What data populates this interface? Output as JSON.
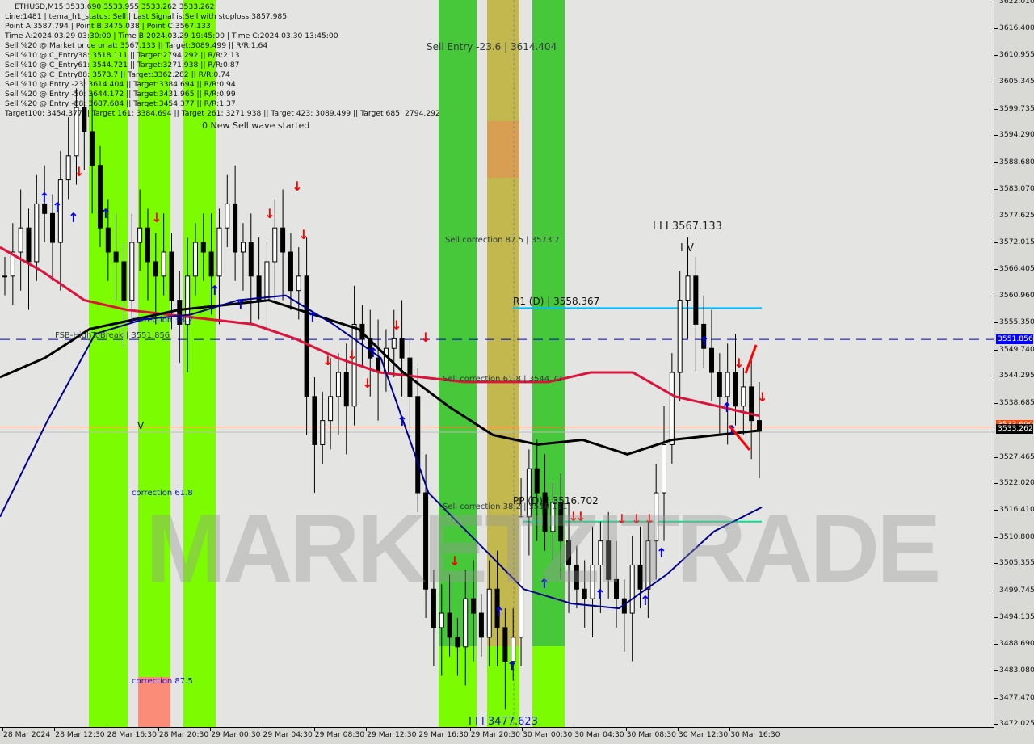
{
  "window": {
    "symbol_line": "ETHUSD,M15  3533.690 3533.955 3533.262 3533.262"
  },
  "info_panel": {
    "lines": [
      "Line:1481 | tema_h1_status: Sell | Last Signal is:Sell with stoploss:3857.985",
      "Point A:3587.794 | Point B:3475.038 | Point C:3567.133",
      "Time A:2024.03.29 03:30:00 | Time B:2024.03.29 19:45:00 | Time C:2024.03.30 13:45:00",
      "Sell %20 @ Market price or at: 3567.133 || Target:3089.499 || R/R:1.64",
      "Sell %10 @ C_Entry38: 3518.111 || Target:2794.292 || R/R:2.13",
      "Sell %10 @ C_Entry61: 3544.721 || Target:3271.938 || R/R:0.87",
      "Sell %10 @ C_Entry88: 3573.7 || Target:3362.282 || R/R:0.74",
      "Sell %10 @ Entry -23: 3614.404 || Target:3384.694 || R/R:0.94",
      "Sell %20 @ Entry -50: 3644.172 || Target:3431.965 || R/R:0.99",
      "Sell %20 @ Entry -88: 3687.684 || Target:3454.377 || R/R:1.37",
      "Target100: 3454.377 || Target 161: 3384.694 || Target 261: 3271.938 || Target 423: 3089.499 || Target 685: 2794.292"
    ],
    "wave_status": "0 New Sell wave started"
  },
  "annotations": {
    "sell_entry": "Sell Entry -23.6 | 3614.404",
    "sell_corr_875": "Sell correction 87.5 | 3573.7",
    "sell_corr_618": "Sell correction 61.8 | 3544.72",
    "sell_corr_382": "Sell correction 38.2 | 3518.111",
    "r1": "R1 (D) | 3558.367",
    "pp": "PP (D) | 3516.702",
    "point_c": "I I I 3567.133",
    "wave_iv": "I V",
    "point_b": "I I I 3477.623",
    "fsb": "FSB-HighToBreak | 3551.856",
    "corr_382": "correction 38.2",
    "corr_618": "correction 61.8",
    "corr_875": "correction 87.5",
    "wave_v": "V",
    "watermark": "MARKETZITRADE"
  },
  "colors": {
    "background": "#e4e4e2",
    "band_lime": "#7cfc00",
    "band_green": "#46c83a",
    "band_olive": "#c2b84e",
    "band_salmon": "#fa8c78",
    "ma_red": "#dc143c",
    "ma_black": "#000000",
    "ma_navy": "#00008b",
    "r1_line": "#00bfff",
    "pp_line": "#00e58a",
    "fsb_line": "#0000cd",
    "bid_line": "#ff4500",
    "envelope": "#ff4500",
    "tag_blue": "#0000ff",
    "tag_orange": "#ff4500",
    "tag_black": "#000000"
  },
  "chart_data": {
    "type": "candlestick",
    "title": "ETHUSD,M15",
    "ylim": [
      3472.025,
      3622.01
    ],
    "y_ticks": [
      3622.01,
      3616.4,
      3610.955,
      3605.345,
      3599.735,
      3594.29,
      3588.68,
      3583.07,
      3577.625,
      3572.015,
      3566.405,
      3560.96,
      3555.35,
      3549.74,
      3544.295,
      3538.685,
      3533.262,
      3527.465,
      3522.02,
      3516.41,
      3510.8,
      3505.355,
      3499.745,
      3494.135,
      3488.69,
      3483.08,
      3477.47,
      3472.025
    ],
    "x_ticks": [
      "28 Mar 2024",
      "28 Mar 12:30",
      "28 Mar 16:30",
      "28 Mar 20:30",
      "29 Mar 00:30",
      "29 Mar 04:30",
      "29 Mar 08:30",
      "29 Mar 12:30",
      "29 Mar 16:30",
      "29 Mar 20:30",
      "30 Mar 00:30",
      "30 Mar 04:30",
      "30 Mar 08:30",
      "30 Mar 12:30",
      "30 Mar 16:30"
    ],
    "price_tags": [
      {
        "label": "3551.856",
        "value": 3551.856,
        "color": "tag_blue"
      },
      {
        "label": "3533.262",
        "value": 3533.262,
        "color": "tag_black"
      },
      {
        "label": "3533.690",
        "value": 3533.69,
        "color": "tag_orange"
      }
    ],
    "levels": {
      "r1": 3558.367,
      "pp": 3516.702,
      "fsb": 3551.856,
      "bid": 3533.69,
      "last": 3533.262
    },
    "ohlc_close_path": [
      3565,
      3570,
      3575,
      3568,
      3580,
      3578,
      3572,
      3585,
      3590,
      3600,
      3595,
      3588,
      3575,
      3570,
      3568,
      3560,
      3572,
      3575,
      3568,
      3565,
      3570,
      3560,
      3555,
      3565,
      3572,
      3570,
      3565,
      3575,
      3580,
      3570,
      3572,
      3565,
      3560,
      3568,
      3575,
      3570,
      3562,
      3565,
      3540,
      3530,
      3535,
      3540,
      3545,
      3538,
      3555,
      3552,
      3548,
      3545,
      3550,
      3552,
      3548,
      3540,
      3520,
      3500,
      3492,
      3495,
      3490,
      3488,
      3498,
      3495,
      3490,
      3500,
      3492,
      3485,
      3490,
      3515,
      3525,
      3520,
      3512,
      3518,
      3510,
      3505,
      3500,
      3498,
      3505,
      3510,
      3502,
      3498,
      3495,
      3505,
      3500,
      3510,
      3520,
      3530,
      3545,
      3560,
      3565,
      3555,
      3550,
      3545,
      3540,
      3545,
      3538,
      3542,
      3535,
      3533
    ],
    "series": [
      {
        "name": "MA red",
        "color": "ma_red",
        "values": [
          3571,
          3566,
          3560,
          3558,
          3557,
          3556,
          3555,
          3552,
          3548,
          3545,
          3544,
          3543,
          3543,
          3543,
          3545,
          3545,
          3540,
          3538,
          3536
        ]
      },
      {
        "name": "MA black",
        "color": "ma_black",
        "values": [
          3544,
          3548,
          3554,
          3556,
          3558,
          3559,
          3560,
          3557,
          3554,
          3545,
          3538,
          3532,
          3530,
          3531,
          3528,
          3531,
          3532,
          3533
        ]
      },
      {
        "name": "MA navy",
        "color": "ma_navy",
        "values": [
          3515,
          3535,
          3553,
          3556,
          3557,
          3560,
          3561,
          3555,
          3548,
          3520,
          3510,
          3500,
          3497,
          3496,
          3503,
          3512,
          3517
        ]
      }
    ]
  }
}
